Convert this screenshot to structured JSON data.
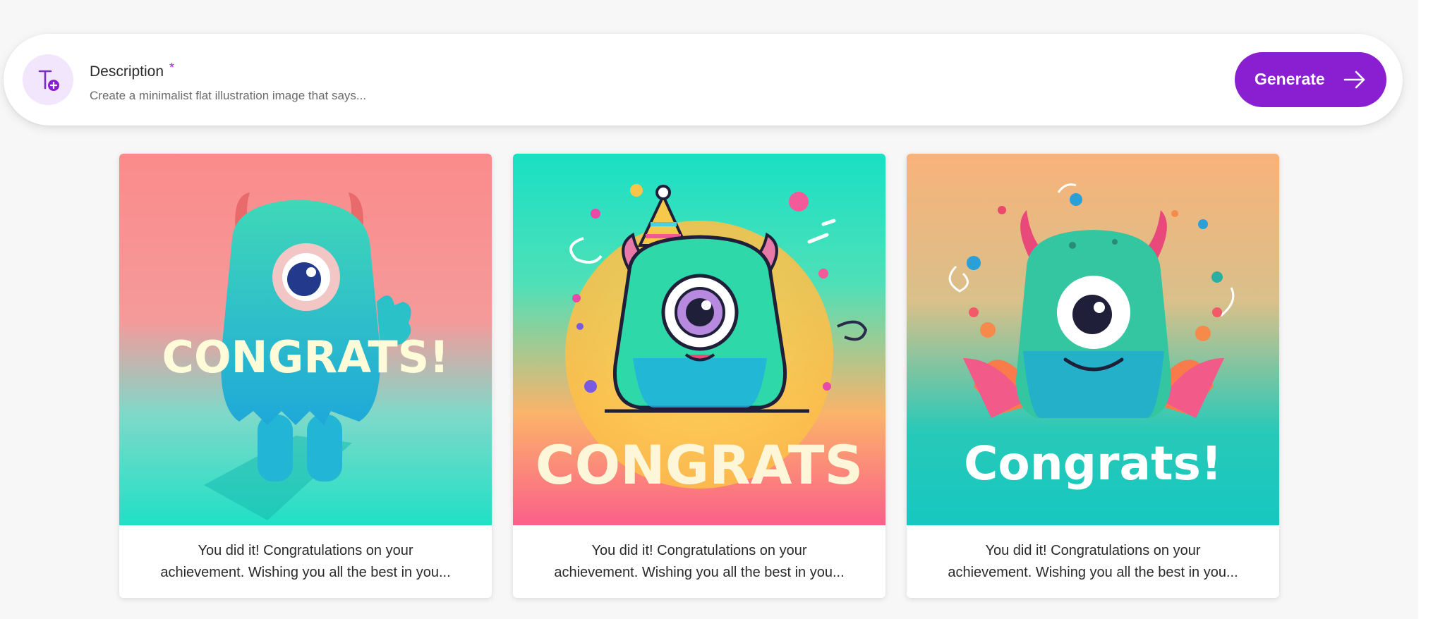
{
  "prompt": {
    "icon": "text-to-image-icon",
    "label": "Description",
    "required_mark": "*",
    "placeholder": "Create a minimalist flat illustration image that says...",
    "generate_label": "Generate",
    "accent_color": "#8a1fd2"
  },
  "cards": [
    {
      "image_text": "CONGRATS!",
      "caption_line1": "You did it! Congratulations on your",
      "caption_line2": "achievement. Wishing you all the best in you..."
    },
    {
      "image_text": "CONGRATS",
      "caption_line1": "You did it! Congratulations on your",
      "caption_line2": "achievement. Wishing you all the best in you..."
    },
    {
      "image_text": "Congrats!",
      "caption_line1": "You did it! Congratulations on your",
      "caption_line2": "achievement. Wishing you all the best in you..."
    }
  ]
}
